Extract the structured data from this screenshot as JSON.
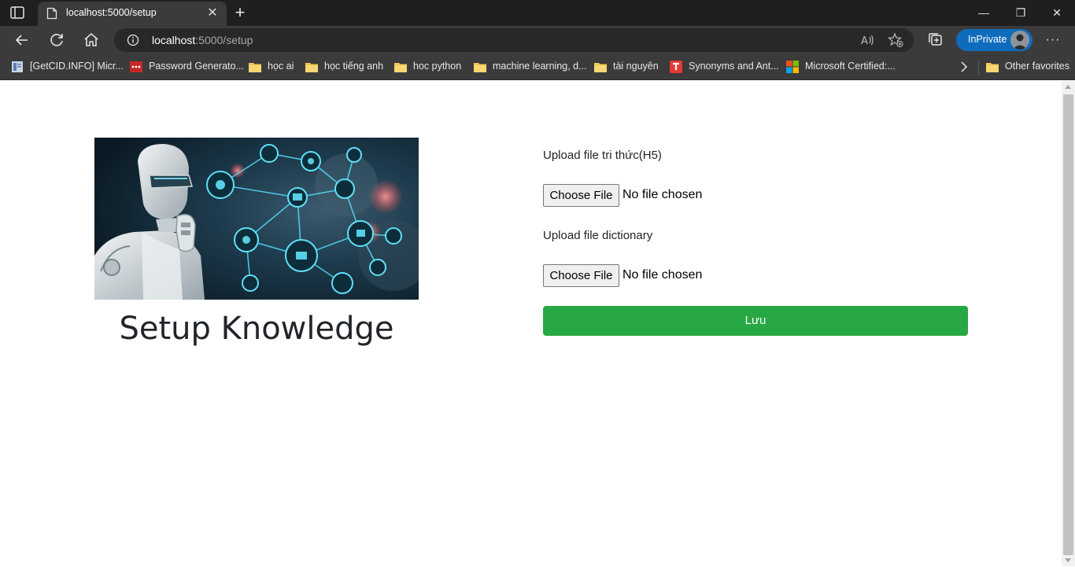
{
  "browser": {
    "tab": {
      "title": "localhost:5000/setup",
      "close_glyph": "✕"
    },
    "new_tab_glyph": "+",
    "window_controls": {
      "minimize": "—",
      "restore": "❐",
      "close": "✕"
    },
    "address": {
      "host": "localhost",
      "path": ":5000/setup"
    },
    "inprivate_label": "InPrivate",
    "more_glyph": "···",
    "favorites": [
      {
        "label": "[GetCID.INFO] Micr...",
        "icon": "page-icon"
      },
      {
        "label": "Password Generato...",
        "icon": "password-icon"
      },
      {
        "label": "học ai",
        "icon": "folder-icon"
      },
      {
        "label": "học tiếng anh",
        "icon": "folder-icon"
      },
      {
        "label": "hoc python",
        "icon": "folder-icon"
      },
      {
        "label": "machine learning, d...",
        "icon": "folder-icon"
      },
      {
        "label": "tài nguyên",
        "icon": "folder-icon"
      },
      {
        "label": "Synonyms and Ant...",
        "icon": "thesaurus-icon"
      },
      {
        "label": "Microsoft Certified:...",
        "icon": "microsoft-icon"
      }
    ],
    "other_favorites": "Other favorites",
    "colors": {
      "chrome_dark": "#1f1f1f",
      "chrome": "#3b3b3b",
      "inprivate": "#0f6cbd"
    }
  },
  "page": {
    "title": "Setup Knowledge",
    "hero_image": "ai-robot-network-image",
    "form": {
      "knowledge_label": "Upload file tri thức(H5)",
      "knowledge_button": "Choose File",
      "knowledge_status": "No file chosen",
      "dictionary_label": "Upload file dictionary",
      "dictionary_button": "Choose File",
      "dictionary_status": "No file chosen",
      "submit_label": "Lưu"
    },
    "colors": {
      "submit": "#28a745",
      "text": "#212529"
    }
  }
}
